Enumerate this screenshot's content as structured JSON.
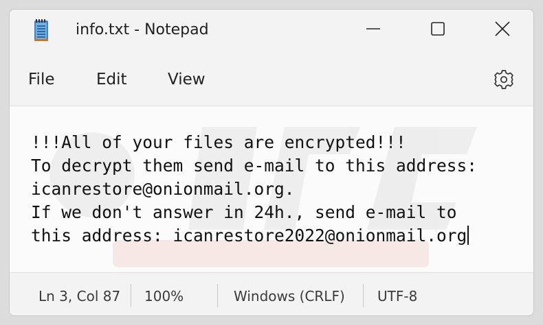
{
  "window": {
    "title": "info.txt - Notepad",
    "app_icon": "notepad-icon",
    "controls": {
      "minimize_icon": "minimize-icon",
      "maximize_icon": "maximize-icon",
      "close_icon": "close-icon"
    }
  },
  "menu": {
    "items": [
      "File",
      "Edit",
      "View"
    ],
    "settings_icon": "gear-icon"
  },
  "editor": {
    "lines": [
      "!!!All of your files are encrypted!!!",
      "To decrypt them send e-mail to this address:",
      "icanrestore@onionmail.org.",
      "If we don't answer in 24h., send e-mail to",
      "this address: icanrestore2022@onionmail.org"
    ]
  },
  "statusbar": {
    "position": "Ln 3, Col 87",
    "zoom": "100%",
    "line_ending": "Windows (CRLF)",
    "encoding": "UTF-8"
  },
  "colors": {
    "window_bg": "#f3f3f3",
    "editor_bg": "#fbfbfb",
    "text": "#111111",
    "status_text": "#3a3a3a"
  }
}
